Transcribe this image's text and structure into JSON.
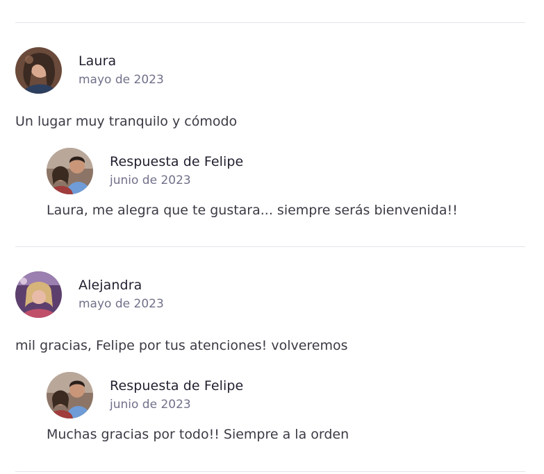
{
  "reviews": [
    {
      "name": "Laura",
      "date": "mayo de 2023",
      "text": "Un lugar muy tranquilo y cómodo",
      "avatar_icon": "user-photo-icon",
      "reply": {
        "title": "Respuesta de Felipe",
        "date": "junio de 2023",
        "text": "Laura, me alegra que te gustara... siempre serás bienvenida!!",
        "avatar_icon": "host-photo-icon"
      }
    },
    {
      "name": "Alejandra",
      "date": "mayo de 2023",
      "text": "mil gracias, Felipe por tus atenciones! volveremos",
      "avatar_icon": "user-photo-icon",
      "reply": {
        "title": "Respuesta de Felipe",
        "date": "junio de 2023",
        "text": "Muchas gracias por todo!! Siempre a la orden",
        "avatar_icon": "host-photo-icon"
      }
    }
  ],
  "colors": {
    "divider": "#e4e4ea",
    "name": "#1f1f2e",
    "date": "#70708a",
    "text": "#3a3a44"
  }
}
